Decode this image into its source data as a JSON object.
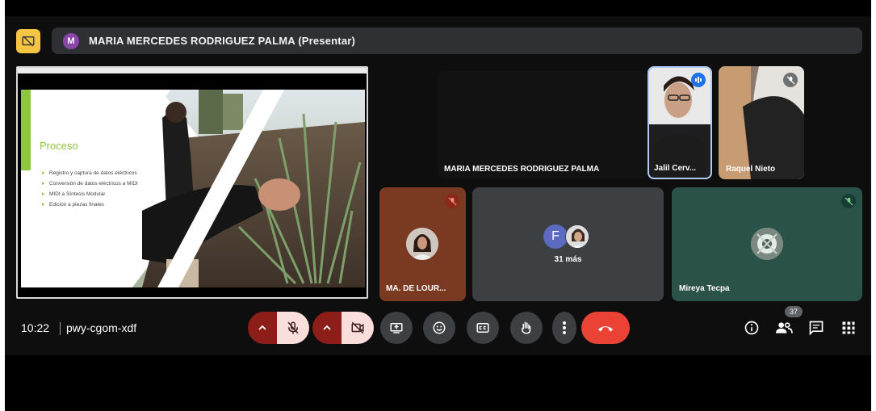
{
  "presenter": {
    "avatar_letter": "M",
    "name": "MARIA MERCEDES RODRIGUEZ PALMA (Presentar)"
  },
  "shared_screen": {
    "slide_title": "Proceso",
    "bullets": [
      "Registro y captura de datos eléctricos",
      "Conversión de datos eléctricos a MIDI",
      "MIDI a Síntesis Modular",
      "Edición a piezas finales"
    ]
  },
  "tiles": {
    "maria": {
      "name": "MARIA MERCEDES RODRIGUEZ PALMA"
    },
    "jalil": {
      "name": "Jalil Cerv..."
    },
    "raquel": {
      "name": "Raquel Nieto"
    },
    "ma": {
      "name": "MA. DE LOUR..."
    },
    "more": {
      "avatar_letter": "F",
      "label": "31 más"
    },
    "mireya": {
      "name": "Mireya Tecpa"
    }
  },
  "meeting": {
    "time": "10:22",
    "code": "pwy-cgom-xdf",
    "participant_count": "37"
  },
  "colors": {
    "accent_yellow": "#f5c443",
    "end_call_red": "#ea4335",
    "muted_pill": "#f9dedc",
    "slide_green": "#8dc63f"
  },
  "icons": [
    "present-screen-icon",
    "mic-off-icon",
    "camera-off-icon",
    "present-now-icon",
    "emoji-icon",
    "captions-icon",
    "raise-hand-icon",
    "more-options-icon",
    "end-call-icon",
    "info-icon",
    "people-icon",
    "chat-icon",
    "activities-icon"
  ]
}
